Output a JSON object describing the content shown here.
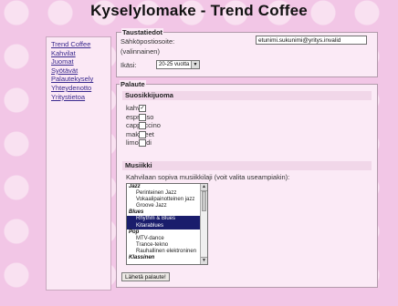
{
  "page": {
    "title": "Kyselylomake - Trend Coffee"
  },
  "nav": {
    "links": [
      "Trend Coffee",
      "Kahvilat",
      "Juomat",
      "Syötävät",
      "Palautekysely",
      "Yhteydenotto",
      "Yritystietoa"
    ]
  },
  "background_info": {
    "legend": "Taustatiedot",
    "email_label": "Sähköpostiosoite:",
    "email_value": "etunimi.sukunimi@yritys.invalid",
    "optional_note": "(valinnainen)",
    "age_label": "Ikäsi:",
    "age_selected": "20-25 vuotta"
  },
  "feedback": {
    "legend": "Palaute",
    "favorites": {
      "header": "Suosikkijuoma",
      "items": [
        {
          "label": "kahvi",
          "checked": "✓"
        },
        {
          "label": "espresso",
          "checked": ""
        },
        {
          "label": "cappuccino",
          "checked": ""
        },
        {
          "label": "makuteet",
          "checked": ""
        },
        {
          "label": "limonadi",
          "checked": ""
        }
      ]
    },
    "music": {
      "header": "Musiikki",
      "question": "Kahvilaan sopiva musiikkilaji (voit valita useampiakin):",
      "options": [
        {
          "text": "Jazz",
          "group": true,
          "selected": false
        },
        {
          "text": "Perinteinen Jazz",
          "group": false,
          "selected": false
        },
        {
          "text": "Vokaalipainotteinen jazz",
          "group": false,
          "selected": false
        },
        {
          "text": "Groove Jazz",
          "group": false,
          "selected": false
        },
        {
          "text": "Blues",
          "group": true,
          "selected": false
        },
        {
          "text": "Rhythm & Blues",
          "group": false,
          "selected": true
        },
        {
          "text": "Kitarablues",
          "group": false,
          "selected": true
        },
        {
          "text": "Pop",
          "group": true,
          "selected": false
        },
        {
          "text": "MTV-dance",
          "group": false,
          "selected": false
        },
        {
          "text": "Trance-tekno",
          "group": false,
          "selected": false
        },
        {
          "text": "Rauhallinen elektroninen",
          "group": false,
          "selected": false
        },
        {
          "text": "Klassinen",
          "group": true,
          "selected": false
        }
      ]
    },
    "submit_label": "Lähetä palaute!"
  },
  "colors": {
    "background": "#f2c6e6",
    "panel": "#fbeaf6",
    "link": "#3a2a8e",
    "selection": "#1a1d6c"
  }
}
